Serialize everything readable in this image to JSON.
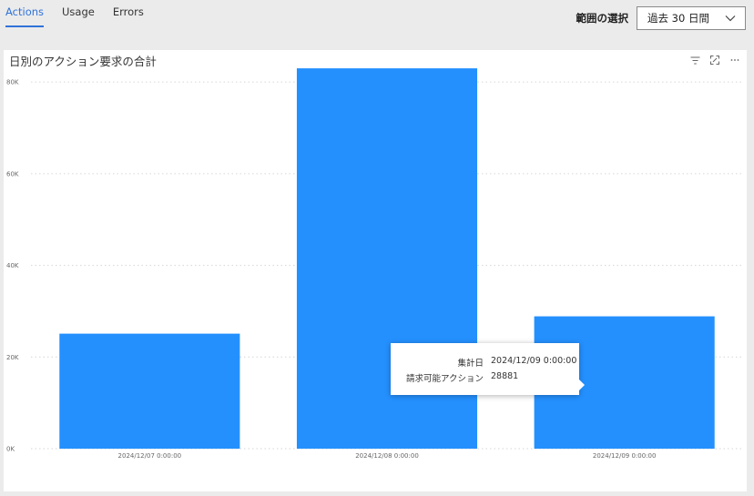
{
  "tabs": [
    {
      "label": "Actions",
      "active": true
    },
    {
      "label": "Usage",
      "active": false
    },
    {
      "label": "Errors",
      "active": false
    }
  ],
  "range": {
    "label": "範囲の選択",
    "value": "過去 30 日間"
  },
  "toolbar_icons": [
    "filter-icon",
    "expand-icon",
    "more-icon"
  ],
  "chart_data": {
    "type": "bar",
    "title": "日別のアクション要求の合計",
    "categories": [
      "2024/12/07 0:00:00",
      "2024/12/08 0:00:00",
      "2024/12/09 0:00:00"
    ],
    "values": [
      25100,
      83000,
      28881
    ],
    "ylim": [
      0,
      85000
    ],
    "yticks": [
      0,
      20000,
      40000,
      60000,
      80000
    ],
    "ytick_labels": [
      "0K",
      "20K",
      "40K",
      "60K",
      "80K"
    ],
    "xlabel": "",
    "ylabel": "",
    "grid": true,
    "color": "#2490fe"
  },
  "tooltip": {
    "rows": [
      {
        "key": "集計日",
        "value": "2024/12/09 0:00:00"
      },
      {
        "key": "請求可能アクション",
        "value": "28881"
      }
    ]
  },
  "colors": {
    "accent": "#2f73d8",
    "bar": "#2490fe",
    "background": "#ebebeb"
  }
}
